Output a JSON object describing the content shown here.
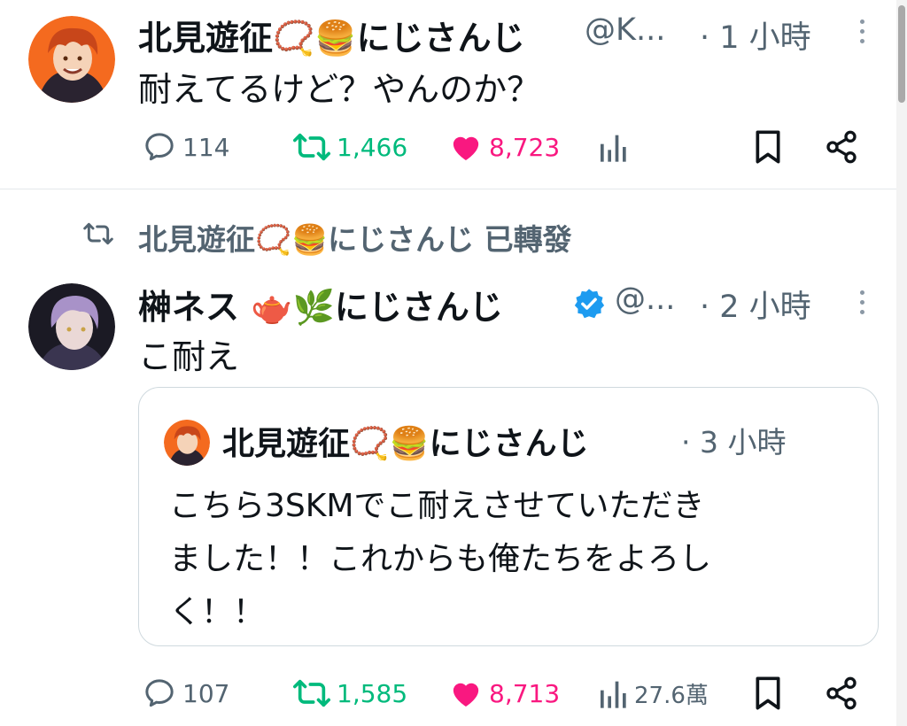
{
  "colors": {
    "text": "#0f1419",
    "secondary": "#536471",
    "retweet": "#00ba7c",
    "like": "#f91880",
    "verified": "#1d9bf0"
  },
  "tweet1": {
    "author": "北見遊征📿🍔にじさんじ",
    "handle": "@K...",
    "time": "· 1 小時",
    "text": "耐えてるけど？やんのか？",
    "replies": "114",
    "retweets": "1,466",
    "likes": "8,723",
    "liked": true
  },
  "retweet_banner": {
    "text": "北見遊征📿🍔にじさんじ 已轉發"
  },
  "tweet2": {
    "author": "榊ネス 🫖🌿にじさんじ",
    "verified": true,
    "handle": "@...",
    "time": "· 2 小時",
    "text": "こ耐え",
    "quote": {
      "author": "北見遊征📿🍔にじさんじ",
      "time": "· 3 小時",
      "lines": [
        "こちら3SKMでこ耐えさせていただき",
        "ました！！これからも俺たちをよろし",
        "く！！"
      ]
    },
    "replies": "107",
    "retweets": "1,585",
    "likes": "8,713",
    "views": "27.6萬",
    "liked": true
  },
  "icons": {
    "reply": "reply-bubble-icon",
    "retweet": "retweet-arrows-icon",
    "like": "heart-icon",
    "views": "bar-chart-icon",
    "bookmark": "bookmark-icon",
    "share": "share-icon",
    "more": "kebab-menu-icon",
    "verified": "verified-badge-icon"
  }
}
